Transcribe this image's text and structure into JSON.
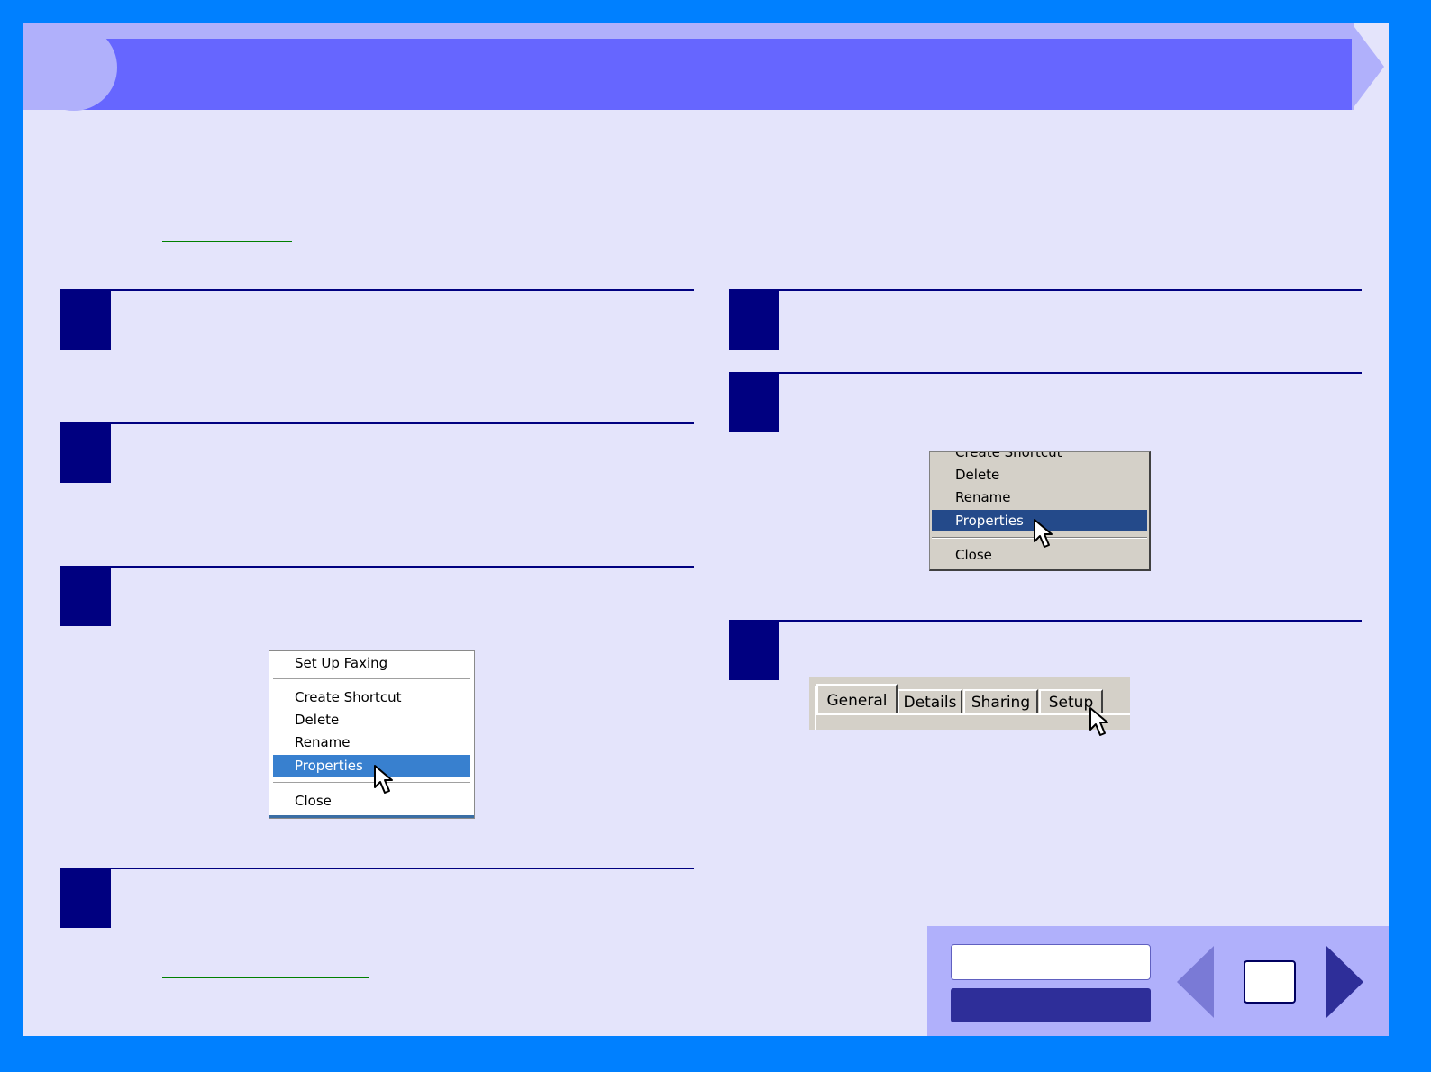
{
  "menu_left": {
    "items": [
      "Set Up Faxing",
      "Create Shortcut",
      "Delete",
      "Rename",
      "Properties",
      "Close"
    ],
    "selected": "Properties"
  },
  "menu_right": {
    "items": [
      "Create Shortcut",
      "Delete",
      "Rename",
      "Properties",
      "Close"
    ],
    "selected": "Properties"
  },
  "tabs": [
    "General",
    "Details",
    "Sharing",
    "Setup"
  ],
  "active_tab": "General",
  "colors": {
    "frame": "#0080ff",
    "page_background": "#e4e4fb",
    "header_bar": "#6666ff",
    "step_marker": "#000080",
    "menu_highlight_left": "#3880cf",
    "menu_highlight_right": "#244a8a",
    "link_underline": "#008000"
  },
  "icons": {
    "cursor": "arrow-pointer-icon",
    "previous": "triangle-left-icon",
    "next": "triangle-right-icon"
  }
}
